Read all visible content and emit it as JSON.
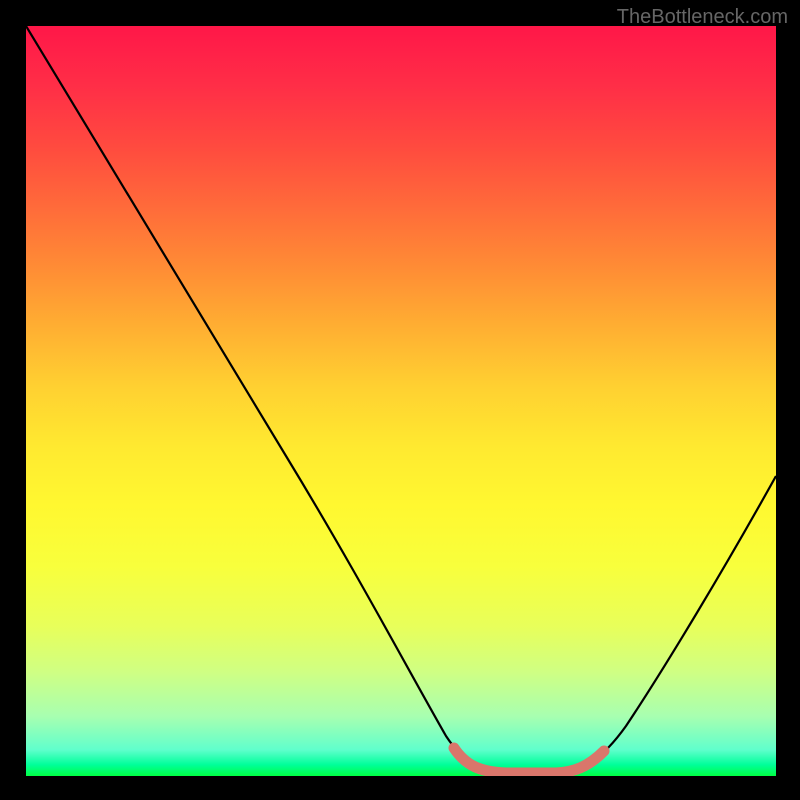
{
  "watermark": "TheBottleneck.com",
  "chart_data": {
    "type": "line",
    "title": "",
    "xlabel": "",
    "ylabel": "",
    "xlim": [
      0,
      100
    ],
    "ylim": [
      0,
      100
    ],
    "series": [
      {
        "name": "bottleneck-curve",
        "x": [
          0,
          10,
          20,
          30,
          40,
          50,
          56,
          60,
          64,
          68,
          72,
          80,
          90,
          100
        ],
        "y": [
          100,
          85,
          70,
          55,
          40,
          24,
          10,
          3,
          0.5,
          0.5,
          2,
          12,
          28,
          46
        ]
      }
    ],
    "highlight": {
      "name": "optimal-range",
      "x": [
        57,
        71
      ],
      "color": "#d9766b"
    },
    "colors": {
      "gradient_top": "#ff1748",
      "gradient_mid": "#ffe930",
      "gradient_bottom": "#00ff44",
      "curve": "#000000",
      "highlight": "#d9766b",
      "background": "#000000"
    }
  }
}
